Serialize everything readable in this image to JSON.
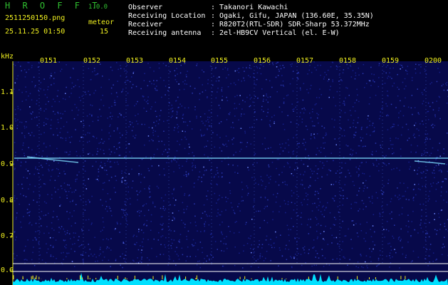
{
  "header": {
    "app_name": "H R O F F T",
    "app_version": "1.0.0",
    "filename": "2511250150.png",
    "meteor_label": "meteor",
    "timestamp": "25.11.25 01:50",
    "meteor_count": "15",
    "fields": [
      {
        "label": "Observer",
        "value": ": Takanori Kawachi"
      },
      {
        "label": "Receiving Location",
        "value": ": Ogaki, Gifu, JAPAN (136.60E, 35.35N)"
      },
      {
        "label": "Receiver",
        "value": ": R820T2(RTL-SDR) SDR-Sharp 53.372MHz"
      },
      {
        "label": "Receiving antenna",
        "value": ": 2el-HB9CV Vertical (el. E-W)"
      }
    ]
  },
  "spectrogram": {
    "y_unit": "kHz",
    "minute_labels": [
      "0151",
      "0152",
      "0153",
      "0154",
      "0155",
      "0156",
      "0157",
      "0158",
      "0159",
      "0200"
    ],
    "y_labels": [
      "1.1",
      "1.0",
      "0.9",
      "0.8",
      "0.7",
      "0.6"
    ],
    "colors": {
      "background": "#07094a",
      "noise": "#2a38b0",
      "carrier": "#7fe0ff",
      "labels": "#f0f020",
      "baseline": "#00e0ff"
    }
  }
}
